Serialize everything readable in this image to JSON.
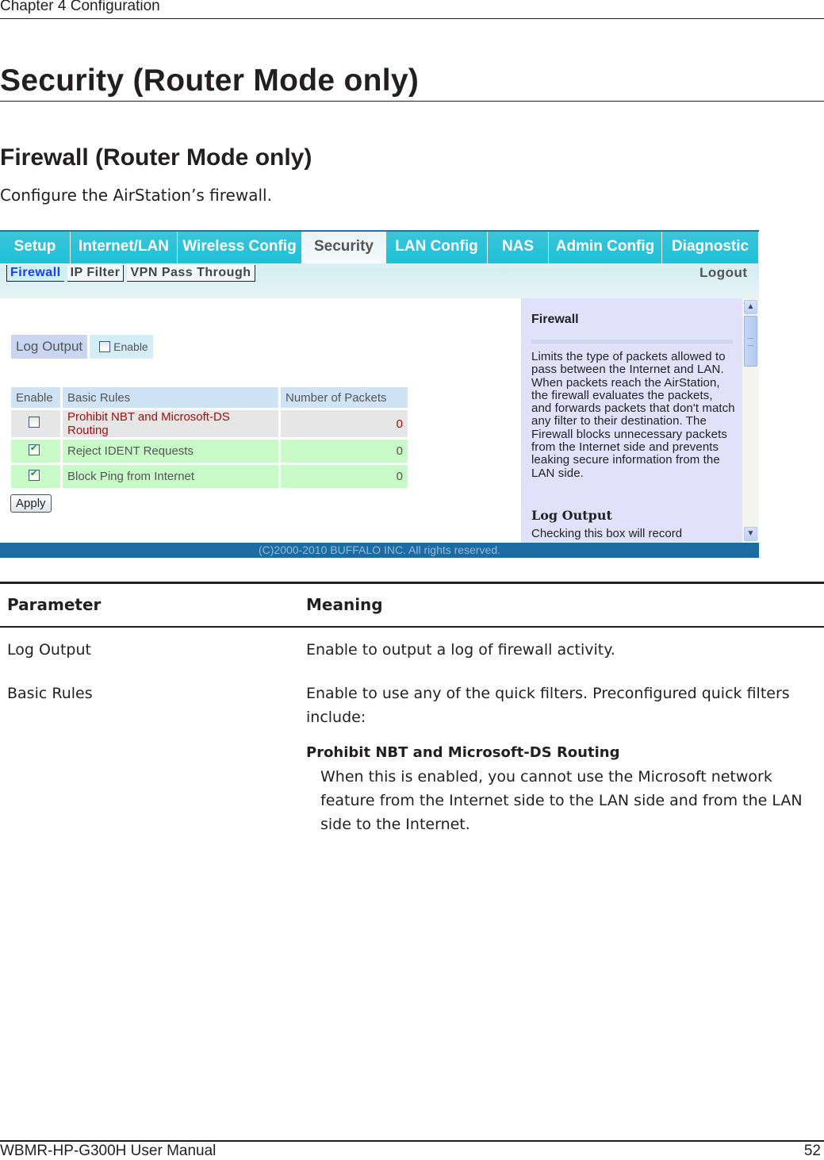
{
  "page": {
    "chapter": "Chapter 4  Configuration",
    "title": "Security (Router Mode only)",
    "section_title": "Firewall (Router Mode only)",
    "intro": "Configure the AirStation’s firewall.",
    "footer_left": "WBMR-HP-G300H User Manual",
    "page_number": "52"
  },
  "screenshot": {
    "tabs": [
      {
        "label": "Setup",
        "active": false
      },
      {
        "label": "Internet/LAN",
        "active": false
      },
      {
        "label": "Wireless Config",
        "active": false
      },
      {
        "label": "Security",
        "active": true
      },
      {
        "label": "LAN Config",
        "active": false
      },
      {
        "label": "NAS",
        "active": false
      },
      {
        "label": "Admin Config",
        "active": false
      },
      {
        "label": "Diagnostic",
        "active": false
      }
    ],
    "subtabs": [
      {
        "label": "Firewall",
        "active": true
      },
      {
        "label": "IP Filter",
        "active": false
      },
      {
        "label": "VPN Pass Through",
        "active": false
      }
    ],
    "logout": "Logout",
    "log_output": {
      "label": "Log Output",
      "checkbox_label": "Enable",
      "checked": false
    },
    "rules_table": {
      "headers": [
        "Enable",
        "Basic Rules",
        "Number of Packets"
      ],
      "rows": [
        {
          "enabled": false,
          "rule": "Prohibit NBT and Microsoft-DS Routing",
          "packets": "0"
        },
        {
          "enabled": true,
          "rule": "Reject IDENT Requests",
          "packets": "0"
        },
        {
          "enabled": true,
          "rule": "Block Ping from Internet",
          "packets": "0"
        }
      ]
    },
    "apply_label": "Apply",
    "help": {
      "title": "Firewall",
      "body": "Limits the type of packets allowed to pass between the Internet and LAN. When packets reach the AirStation, the firewall evaluates the packets, and forwards packets that don't match any filter to their destination. The Firewall blocks unnecessary packets from the Internet side and prevents leaking secure information from the LAN side.",
      "title2": "Log Output",
      "body2": "Checking this box will record"
    },
    "copyright": "(C)2000-2010 BUFFALO INC. All rights reserved.",
    "colors": {
      "tab_bg": "#1ec1d8",
      "footer_bg": "#1b6ca2",
      "help_bg": "#e1e1fb",
      "active_subtab": "#1d3cf0"
    }
  },
  "param_table": {
    "headers": [
      "Parameter",
      "Meaning"
    ],
    "rows": [
      {
        "parameter": "Log Output",
        "meaning": "Enable to output a log of firewall activity."
      },
      {
        "parameter": "Basic Rules",
        "meaning": "Enable to use any of the quick filters. Preconfigured quick filters include:",
        "sub_title": "Prohibit NBT and Microsoft-DS Routing",
        "sub_text": "When this is enabled, you cannot use the Microsoft network feature from the Internet side to the LAN side and from the LAN side to the Internet."
      }
    ]
  }
}
